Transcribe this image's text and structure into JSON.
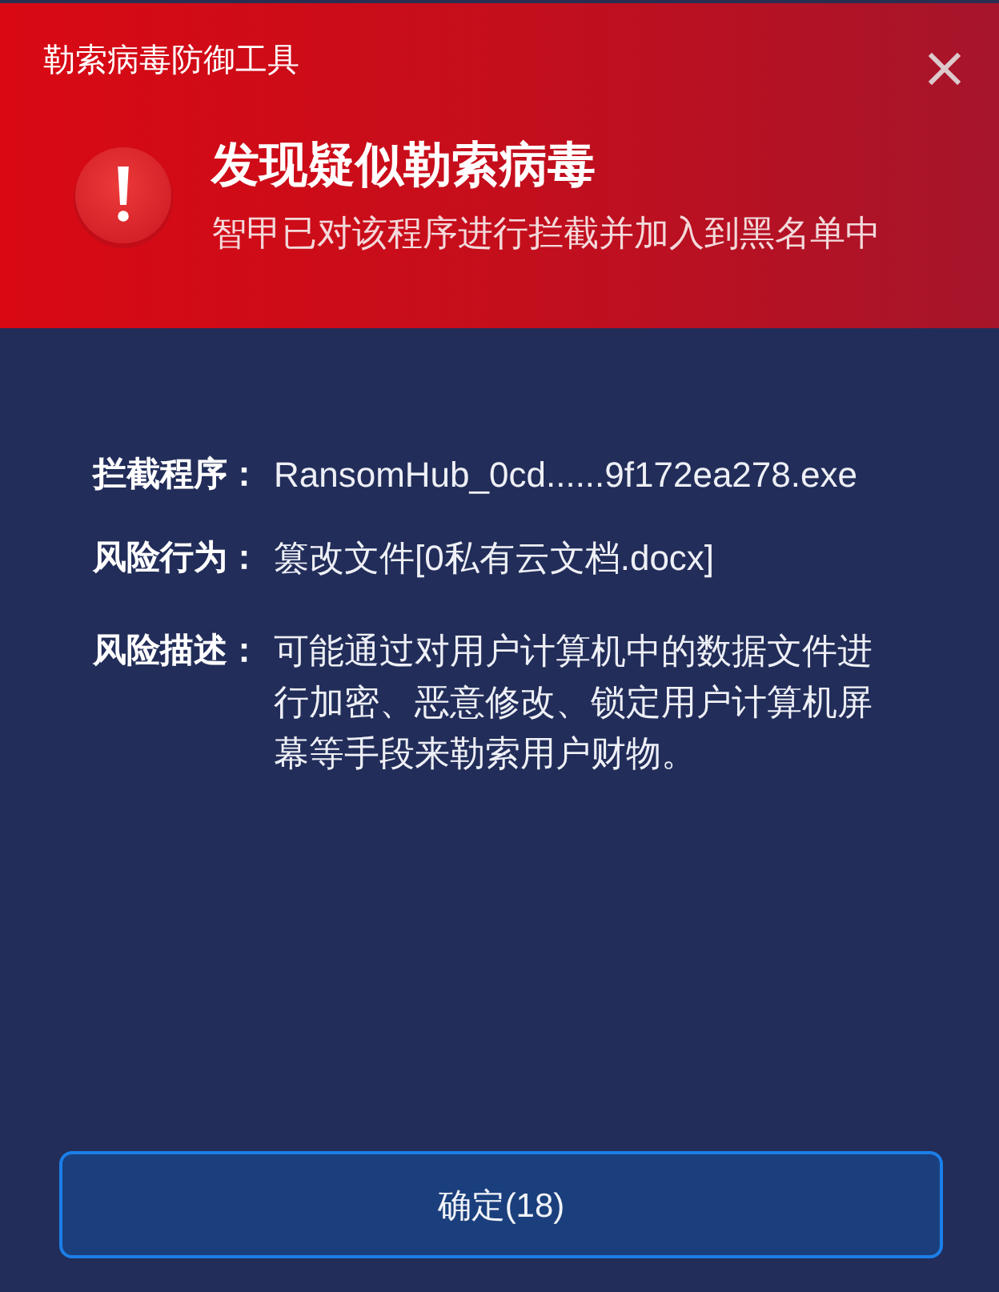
{
  "window": {
    "title": "勒索病毒防御工具"
  },
  "alert": {
    "heading": "发现疑似勒索病毒",
    "message": "智甲已对该程序进行拦截并加入到黑名单中"
  },
  "details": [
    {
      "label": "拦截程序：",
      "value": "RansomHub_0cd......9f172ea278.exe"
    },
    {
      "label": "风险行为：",
      "value": "篡改文件[0私有云文档.docx]"
    },
    {
      "label": "风险描述：",
      "value": "可能通过对用户计算机中的数据文件进行加密、恶意修改、锁定用户计算机屏幕等手段来勒索用户财物。"
    }
  ],
  "buttons": [
    {
      "label": "确定(18)"
    }
  ]
}
